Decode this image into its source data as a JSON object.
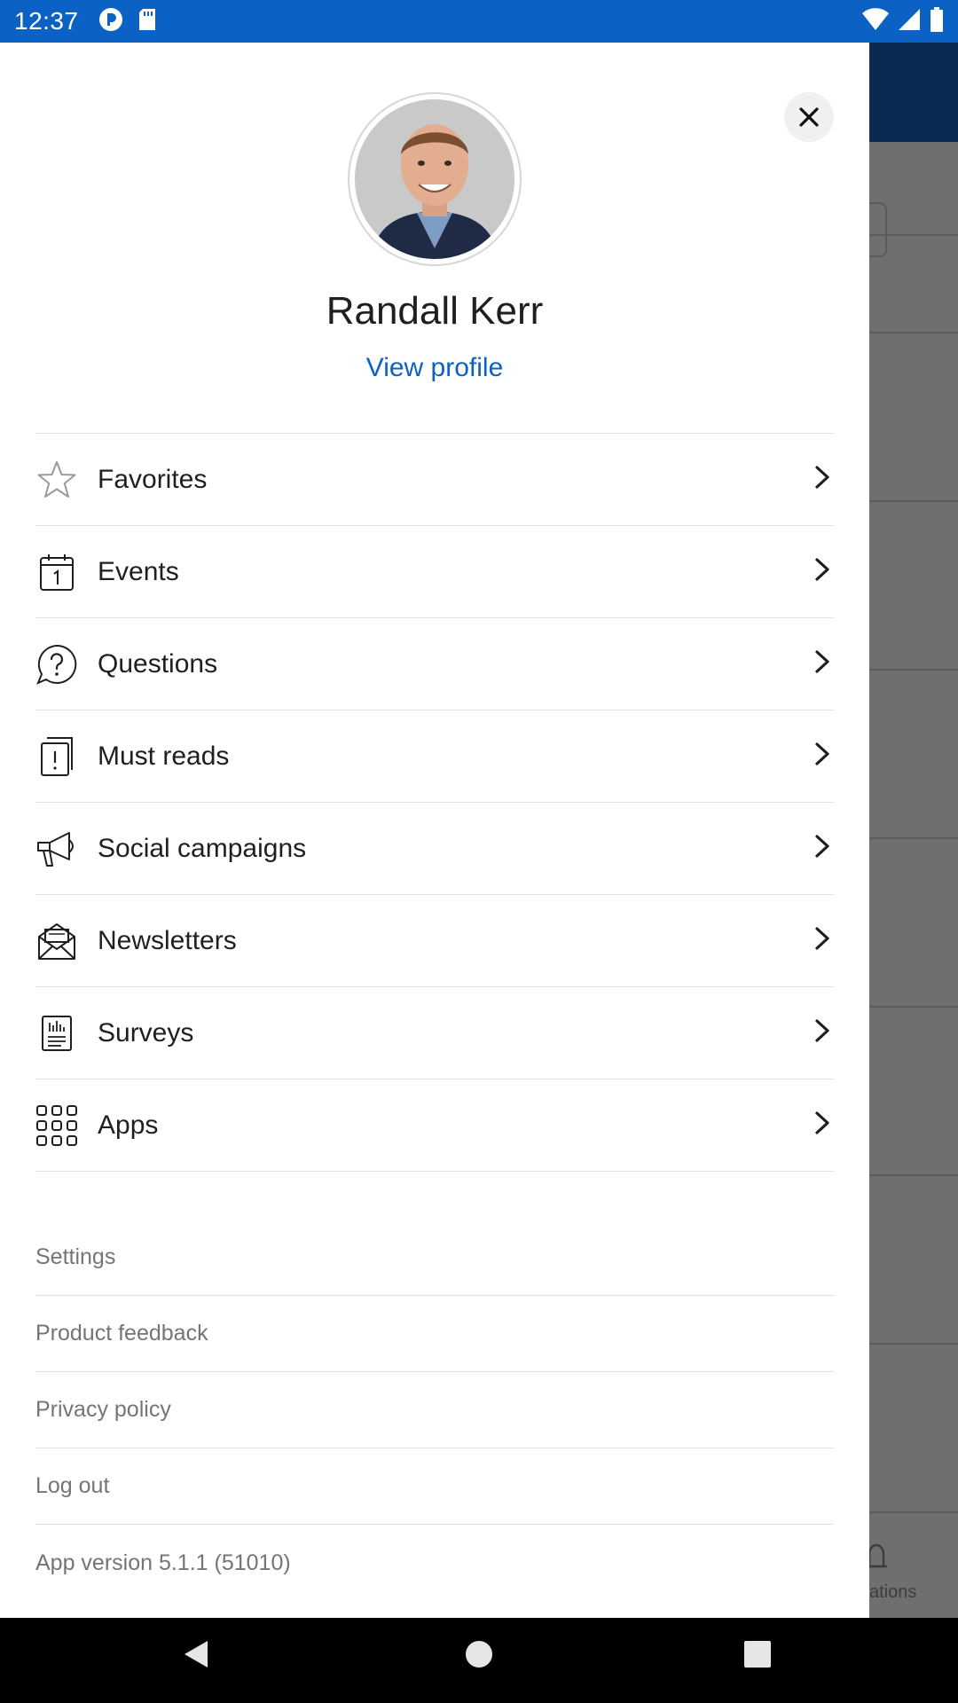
{
  "status_bar": {
    "time": "12:37",
    "icons": [
      "notification-p-icon",
      "sd-card-icon",
      "wifi-icon",
      "cell-signal-icon",
      "battery-icon"
    ]
  },
  "drawer": {
    "profile": {
      "name": "Randall Kerr",
      "view_profile_label": "View profile"
    },
    "menu_items": [
      {
        "label": "Favorites",
        "icon": "star-icon"
      },
      {
        "label": "Events",
        "icon": "calendar-icon"
      },
      {
        "label": "Questions",
        "icon": "question-bubble-icon"
      },
      {
        "label": "Must reads",
        "icon": "must-read-icon"
      },
      {
        "label": "Social campaigns",
        "icon": "megaphone-icon"
      },
      {
        "label": "Newsletters",
        "icon": "newsletter-icon"
      },
      {
        "label": "Surveys",
        "icon": "survey-icon"
      },
      {
        "label": "Apps",
        "icon": "apps-grid-icon"
      }
    ],
    "links": [
      {
        "label": "Settings"
      },
      {
        "label": "Product feedback"
      },
      {
        "label": "Privacy policy"
      },
      {
        "label": "Log out"
      }
    ],
    "app_version": "App version 5.1.1 (51010)"
  },
  "background_app": {
    "bottom_tab_partial_label": "ations"
  },
  "colors": {
    "status_bar": "#0b62c4",
    "link": "#0b62c4",
    "overlay": "#6f6f6f"
  }
}
